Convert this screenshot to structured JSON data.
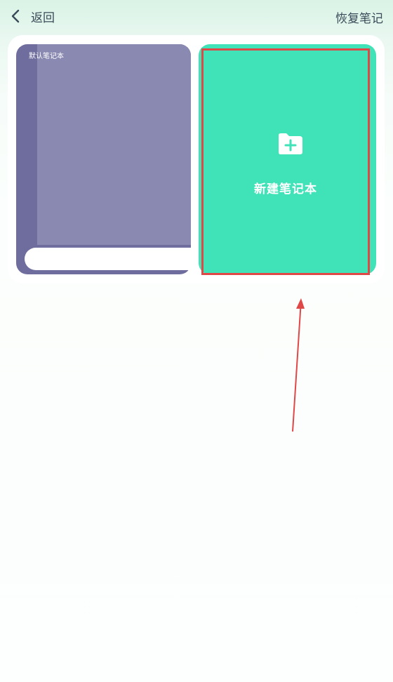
{
  "header": {
    "back_label": "返回",
    "restore_label": "恢复笔记"
  },
  "notebooks": {
    "default": {
      "title": "默认笔记本",
      "spine_color": "#6e6d9e",
      "cover_color": "#8a89b2"
    },
    "new_card": {
      "label": "新建笔记本",
      "icon": "folder-plus-icon",
      "color": "#40e2b8",
      "highlight_color": "#e04848"
    }
  },
  "annotation": {
    "arrow_color": "#e04848"
  }
}
